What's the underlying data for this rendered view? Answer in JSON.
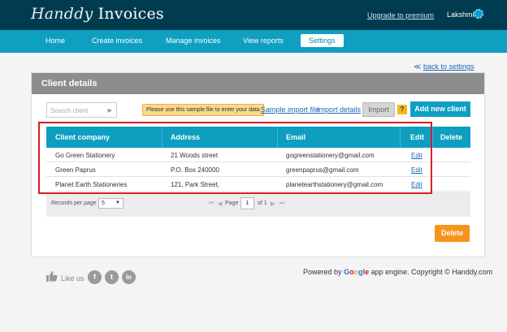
{
  "header": {
    "logo_part1": "Handdy",
    "logo_part2": "Invoices",
    "upgrade_link": "Upgrade to premium",
    "user_name": "Lakshmi"
  },
  "nav": {
    "items": [
      {
        "label": "Home"
      },
      {
        "label": "Create invoices"
      },
      {
        "label": "Manage invoices"
      },
      {
        "label": "View reports"
      },
      {
        "label": "Settings"
      }
    ],
    "active": "Settings"
  },
  "back_link": {
    "arrow": "≪",
    "label": "back to settings"
  },
  "panel": {
    "title": "Client details"
  },
  "toolbar": {
    "search_placeholder": "Search client",
    "sample_note": "Please use this sample file to enter your data",
    "sample_link": "Sample import file",
    "import_details_link": "Import details",
    "import_button": "Import",
    "help_label": "?",
    "add_button": "Add new client"
  },
  "table": {
    "columns": [
      "Client company",
      "Address",
      "Email",
      "Edit",
      "Delete"
    ],
    "rows": [
      {
        "company": "Go Green Stationery",
        "address": "21 Woods street",
        "email": "gogreenstationery@gmail.com",
        "edit": "Edit"
      },
      {
        "company": "Green Paprus",
        "address": "P.O. Box 240000",
        "email": "greenpaprus@gmail.com",
        "edit": "Edit"
      },
      {
        "company": "Planet Earth Stationeries",
        "address": "121, Park Street,",
        "email": "planetearthstationery@gmail.com",
        "edit": "Edit"
      }
    ]
  },
  "pager": {
    "records_label": "Records per page",
    "records_value": "5",
    "first": "⏮",
    "prev": "◀",
    "page_label": "Page",
    "page_value": "1",
    "of_label": "of 1",
    "next": "▶",
    "last": "⏭"
  },
  "delete_button": "Delete",
  "footer": {
    "like_text": "Like us",
    "social": [
      "f",
      "t",
      "in"
    ],
    "powered_prefix": "Powered by",
    "google": "Google",
    "powered_suffix": "app engine. Copyright © Handdy.com"
  },
  "colors": {
    "header_bg": "#003b4f",
    "nav_bg": "#0fa0c1",
    "highlight": "#d71f26",
    "delete": "#f7941d"
  }
}
